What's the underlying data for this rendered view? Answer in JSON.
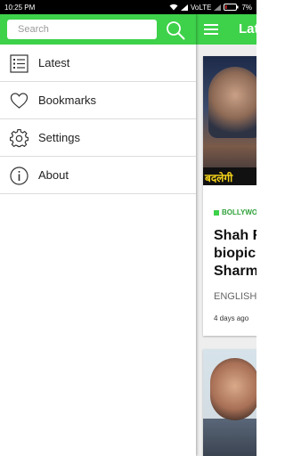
{
  "status_bar": {
    "time": "10:25 PM",
    "network": "VoLTE",
    "battery": "7%"
  },
  "main": {
    "title": "Lat",
    "card": {
      "category": "BOLLYWOO",
      "headline": "Shah R\nbiopic\nSharm",
      "source": "ENGLISH",
      "time": "4 days ago",
      "image_text": "बदलेगी"
    }
  },
  "drawer": {
    "search": {
      "placeholder": "Search",
      "value": ""
    },
    "items": [
      {
        "label": "Latest",
        "icon": "list-icon"
      },
      {
        "label": "Bookmarks",
        "icon": "heart-icon"
      },
      {
        "label": "Settings",
        "icon": "gear-icon"
      },
      {
        "label": "About",
        "icon": "info-icon"
      }
    ]
  },
  "colors": {
    "accent": "#3ed14a",
    "status_bar": "#000000",
    "divider": "#dcdcdc"
  }
}
